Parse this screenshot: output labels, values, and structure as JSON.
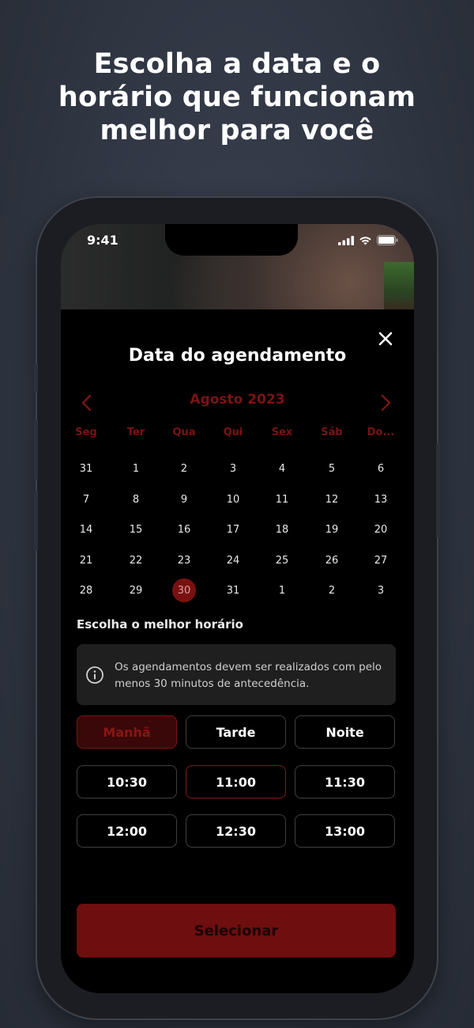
{
  "headline": {
    "line1": "Escolha a data e o",
    "line2": "horário que funcionam",
    "line3": "melhor para você"
  },
  "status_bar": {
    "time": "9:41",
    "icons": [
      "signal-icon",
      "wifi-icon",
      "battery-icon"
    ]
  },
  "sheet": {
    "title": "Data do agendamento",
    "close_icon": "close-icon"
  },
  "calendar": {
    "month_label": "Agosto 2023",
    "prev_icon": "chevron-left-icon",
    "next_icon": "chevron-right-icon",
    "weekdays": [
      "Seg",
      "Ter",
      "Qua",
      "Qui",
      "Sex",
      "Sáb",
      "Do..."
    ],
    "weeks": [
      [
        "31",
        "1",
        "2",
        "3",
        "4",
        "5",
        "6"
      ],
      [
        "7",
        "8",
        "9",
        "10",
        "11",
        "12",
        "13"
      ],
      [
        "14",
        "15",
        "16",
        "17",
        "18",
        "19",
        "20"
      ],
      [
        "21",
        "22",
        "23",
        "24",
        "25",
        "26",
        "27"
      ],
      [
        "28",
        "29",
        "30",
        "31",
        "1",
        "2",
        "3"
      ]
    ],
    "selected_day": "30"
  },
  "schedule": {
    "section_label": "Escolha o melhor horário",
    "info_text": "Os agendamentos devem ser realizados com pelo menos 30 minutos de antecedência.",
    "info_icon": "info-icon",
    "periods": [
      "Manhã",
      "Tarde",
      "Noite"
    ],
    "selected_period": "Manhã",
    "times": [
      "10:30",
      "11:00",
      "11:30",
      "12:00",
      "12:30",
      "13:00"
    ],
    "selected_time": "11:00",
    "submit_label": "Selecionar"
  },
  "colors": {
    "accent": "#7a1414",
    "cta": "#6e0e0e",
    "background": "#2f3541"
  }
}
